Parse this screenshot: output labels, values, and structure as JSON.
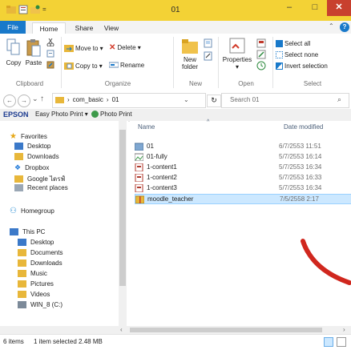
{
  "window": {
    "title": "01",
    "min_glyph": "–",
    "max_glyph": "□",
    "close_glyph": "✕",
    "accent_titlebar": "#f3d235",
    "accent_file": "#1979ca"
  },
  "ribbon_tabs": {
    "file": "File",
    "home": "Home",
    "share": "Share",
    "view": "View"
  },
  "ribbon": {
    "clipboard": {
      "label": "Clipboard",
      "copy": "Copy",
      "paste": "Paste"
    },
    "organize": {
      "label": "Organize",
      "move_to": "Move to ▾",
      "copy_to": "Copy to ▾",
      "delete": "Delete ▾",
      "rename": "Rename"
    },
    "new": {
      "label": "New",
      "new_folder": "New\nfolder"
    },
    "open": {
      "label": "Open",
      "properties": "Properties\n▾"
    },
    "select": {
      "label": "Select",
      "select_all": "Select all",
      "select_none": "Select none",
      "invert": "Invert selection"
    }
  },
  "address": {
    "path": [
      "com_basic",
      "01"
    ],
    "search_placeholder": "Search 01"
  },
  "epson": {
    "brand": "EPSON",
    "easy_photo": "Easy Photo Print ▾",
    "photo_print": "Photo Print"
  },
  "nav": {
    "favorites": "Favorites",
    "fav_items": [
      "Desktop",
      "Downloads",
      "Dropbox",
      "Google ไดรฟ์",
      "Recent places"
    ],
    "homegroup": "Homegroup",
    "this_pc": "This PC",
    "pc_items": [
      "Desktop",
      "Documents",
      "Downloads",
      "Music",
      "Pictures",
      "Videos",
      "WIN_8 (C:)"
    ]
  },
  "columns": {
    "name": "Name",
    "date": "Date modified"
  },
  "files": [
    {
      "name": "01",
      "date": "6/7/2553 11:51",
      "icon": "folder-image-icon"
    },
    {
      "name": "01-fully",
      "date": "5/7/2553 16:14",
      "icon": "image-icon"
    },
    {
      "name": "1-content1",
      "date": "5/7/2553 16:34",
      "icon": "document-icon"
    },
    {
      "name": "1-content2",
      "date": "5/7/2553 16:33",
      "icon": "document-icon"
    },
    {
      "name": "1-content3",
      "date": "5/7/2553 16:34",
      "icon": "document-icon"
    },
    {
      "name": "moodle_teacher",
      "date": "7/5/2558 2:17",
      "icon": "archive-icon",
      "selected": true
    }
  ],
  "status": {
    "count": "6 items",
    "selected": "1 item selected 2.48 MB"
  }
}
